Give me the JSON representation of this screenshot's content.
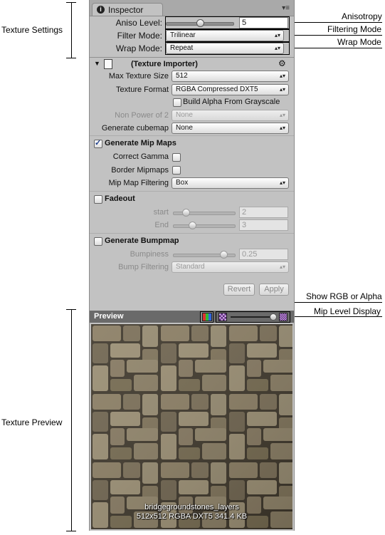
{
  "annotations": {
    "texture_settings": "Texture Settings",
    "texture_preview": "Texture Preview",
    "anisotropy": "Anisotropy",
    "filtering_mode": "Filtering Mode",
    "wrap_mode": "Wrap Mode",
    "show_rgb_alpha": "Show RGB or Alpha",
    "mip_level_display": "Mip Level Display"
  },
  "inspector": {
    "tab_label": "Inspector",
    "aniso_level": {
      "label": "Aniso Level:",
      "value": "5",
      "level": 0.5
    },
    "filter_mode": {
      "label": "Filter Mode:",
      "value": "Trilinear"
    },
    "wrap_mode": {
      "label": "Wrap Mode:",
      "value": "Repeat"
    }
  },
  "importer": {
    "title": "(Texture Importer)",
    "max_texture_size": {
      "label": "Max Texture Size",
      "value": "512"
    },
    "texture_format": {
      "label": "Texture Format",
      "value": "RGBA Compressed DXT5"
    },
    "build_alpha": {
      "label": "Build Alpha From Grayscale",
      "checked": false
    },
    "non_power_of_2": {
      "label": "Non Power of 2",
      "value": "None"
    },
    "generate_cubemap": {
      "label": "Generate cubemap",
      "value": "None"
    },
    "generate_mip_maps": {
      "label": "Generate Mip Maps",
      "checked": true
    },
    "correct_gamma": {
      "label": "Correct Gamma",
      "checked": false
    },
    "border_mipmaps": {
      "label": "Border Mipmaps",
      "checked": false
    },
    "mip_map_filtering": {
      "label": "Mip Map Filtering",
      "value": "Box"
    },
    "fadeout": {
      "label": "Fadeout",
      "checked": false
    },
    "start": {
      "label": "start",
      "value": "2",
      "level": 0.1
    },
    "end": {
      "label": "End",
      "value": "3",
      "level": 0.2
    },
    "generate_bumpmap": {
      "label": "Generate Bumpmap",
      "checked": false
    },
    "bumpiness": {
      "label": "Bumpiness",
      "value": "0.25",
      "level": 0.8
    },
    "bump_filtering": {
      "label": "Bump Filtering",
      "value": "Standard"
    },
    "revert_label": "Revert",
    "apply_label": "Apply"
  },
  "preview": {
    "title": "Preview",
    "texture_name": "bridgegroundstones_layers",
    "texture_info": "512x512  RGBA DXT5  341.4 KB",
    "mip_level": 1.0
  }
}
